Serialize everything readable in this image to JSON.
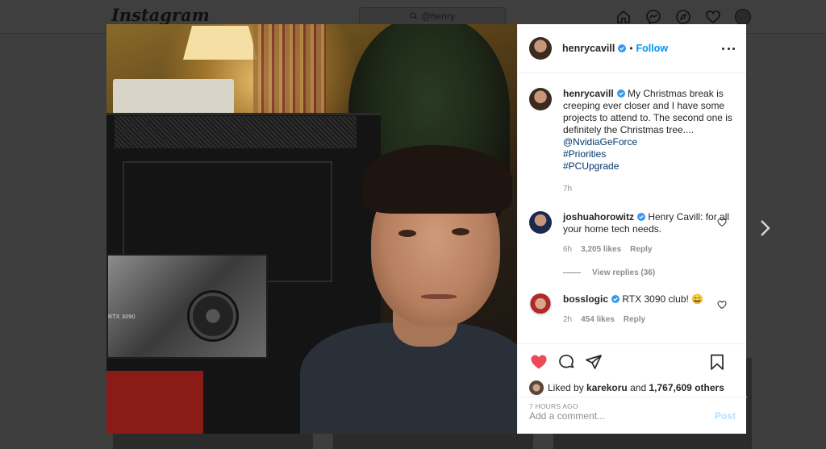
{
  "topbar": {
    "logo": "Instagram",
    "search_value": "@henry"
  },
  "post": {
    "author": "henrycavill",
    "follow_label": "Follow",
    "separator": "•",
    "gpu_text": "RTX 3090",
    "caption": {
      "text": "My Christmas break is creeping ever closer and I have some projects to attend to. The second one is definitely the Christmas tree....",
      "links": [
        "@NvidiaGeForce",
        "#Priorities",
        "#PCUpgrade"
      ],
      "time": "7h"
    },
    "comments": [
      {
        "user": "joshuahorowitz",
        "text": "Henry Cavill: for all your home tech needs.",
        "time": "6h",
        "likes": "3,205 likes",
        "reply": "Reply",
        "view_replies": "View replies (36)"
      },
      {
        "user": "bosslogic",
        "text": "RTX 3090 club! 😄",
        "time": "2h",
        "likes": "454 likes",
        "reply": "Reply"
      }
    ],
    "liked_by_prefix": "Liked by",
    "liked_by_user": "karekoru",
    "liked_by_and": "and",
    "liked_by_count": "1,767,609 others",
    "timestamp": "7 HOURS AGO",
    "comment_placeholder": "Add a comment...",
    "post_label": "Post"
  },
  "colors": {
    "accent": "#0095f6",
    "like_red": "#ed4956",
    "muted": "#8e8e8e"
  }
}
